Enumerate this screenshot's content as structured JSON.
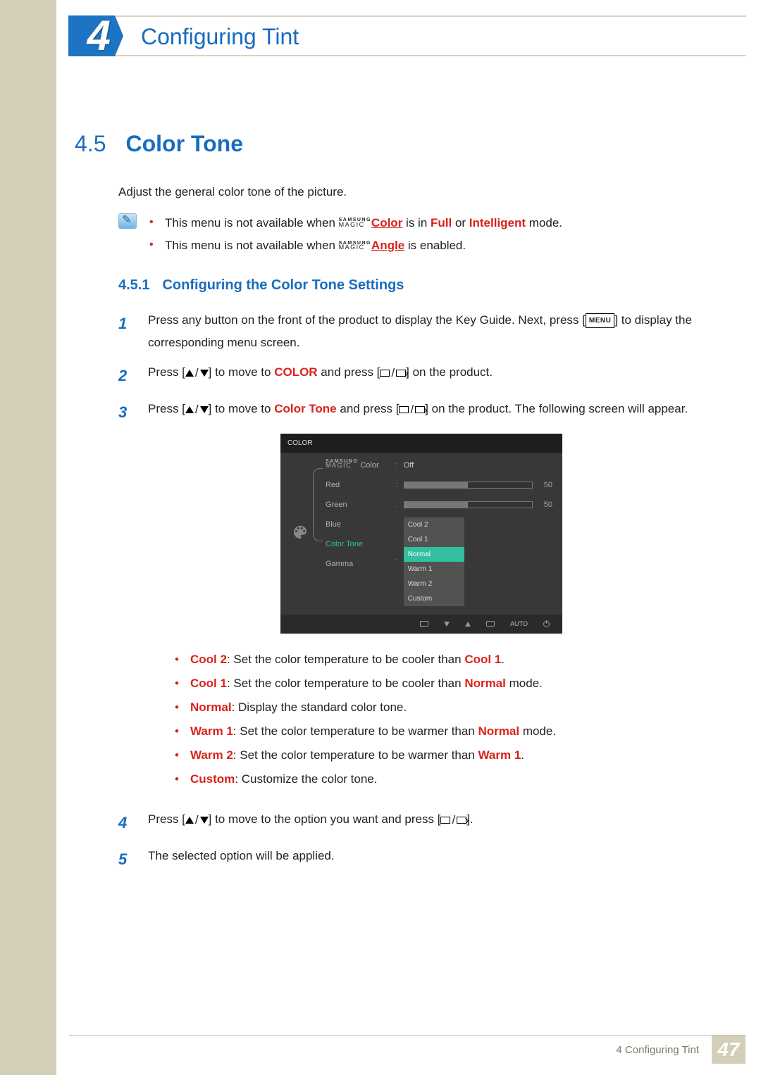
{
  "chapter": {
    "number": "4",
    "title": "Configuring Tint"
  },
  "section": {
    "number": "4.5",
    "title": "Color Tone"
  },
  "intro": "Adjust the general color tone of the picture.",
  "notes": {
    "n1_pre": "This menu is not available when ",
    "magic_color": "Color",
    "n1_mid": " is in ",
    "full": "Full",
    "or": " or ",
    "intelligent": "Intelligent",
    "n1_post": " mode.",
    "n2_pre": "This menu is not available when ",
    "magic_angle": "Angle",
    "n2_post": " is enabled."
  },
  "magic_brand": {
    "top": "SAMSUNG",
    "bottom": "MAGIC"
  },
  "subsection": {
    "number": "4.5.1",
    "title": "Configuring the Color Tone Settings"
  },
  "steps": {
    "s1": "Press any button on the front of the product to display the Key Guide. Next, press [",
    "s1_menu": "MENU",
    "s1_post": "] to display the corresponding menu screen.",
    "s2_pre": "Press [",
    "s2_mid": "] to move to ",
    "s2_color": "COLOR",
    "s2_mid2": " and press [",
    "s2_post": "] on the product.",
    "s3_pre": "Press [",
    "s3_mid": "] to move to ",
    "s3_ct": "Color Tone",
    "s3_mid2": " and press [",
    "s3_post": "] on the product. The following screen will appear.",
    "s4_pre": "Press [",
    "s4_mid": "] to move to the option you want and press [",
    "s4_post": "].",
    "s5": "The selected option will be applied."
  },
  "nums": {
    "s1": "1",
    "s2": "2",
    "s3": "3",
    "s4": "4",
    "s5": "5"
  },
  "osd": {
    "title": "COLOR",
    "labels": {
      "magic": "Color",
      "red": "Red",
      "green": "Green",
      "blue": "Blue",
      "ct": "Color Tone",
      "gamma": "Gamma"
    },
    "off": "Off",
    "red_val": "50",
    "green_val": "50",
    "opts": {
      "cool2": "Cool 2",
      "cool1": "Cool 1",
      "normal": "Normal",
      "warm1": "Warm 1",
      "warm2": "Warm 2",
      "custom": "Custom"
    },
    "auto": "AUTO"
  },
  "options": {
    "cool2_k": "Cool 2",
    "cool2_v": ": Set the color temperature to be cooler than ",
    "cool2_ref": "Cool 1",
    "cool2_end": ".",
    "cool1_k": "Cool 1",
    "cool1_v": ": Set the color temperature to be cooler than ",
    "cool1_ref": "Normal",
    "cool1_end": " mode.",
    "normal_k": "Normal",
    "normal_v": ": Display the standard color tone.",
    "warm1_k": "Warm 1",
    "warm1_v": ": Set the color temperature to be warmer than ",
    "warm1_ref": "Normal",
    "warm1_end": " mode.",
    "warm2_k": "Warm 2",
    "warm2_v": ": Set the color temperature to be warmer than ",
    "warm2_ref": "Warm 1",
    "warm2_end": ".",
    "custom_k": "Custom",
    "custom_v": ": Customize the color tone."
  },
  "footer": {
    "text": "4 Configuring Tint",
    "page": "47"
  }
}
